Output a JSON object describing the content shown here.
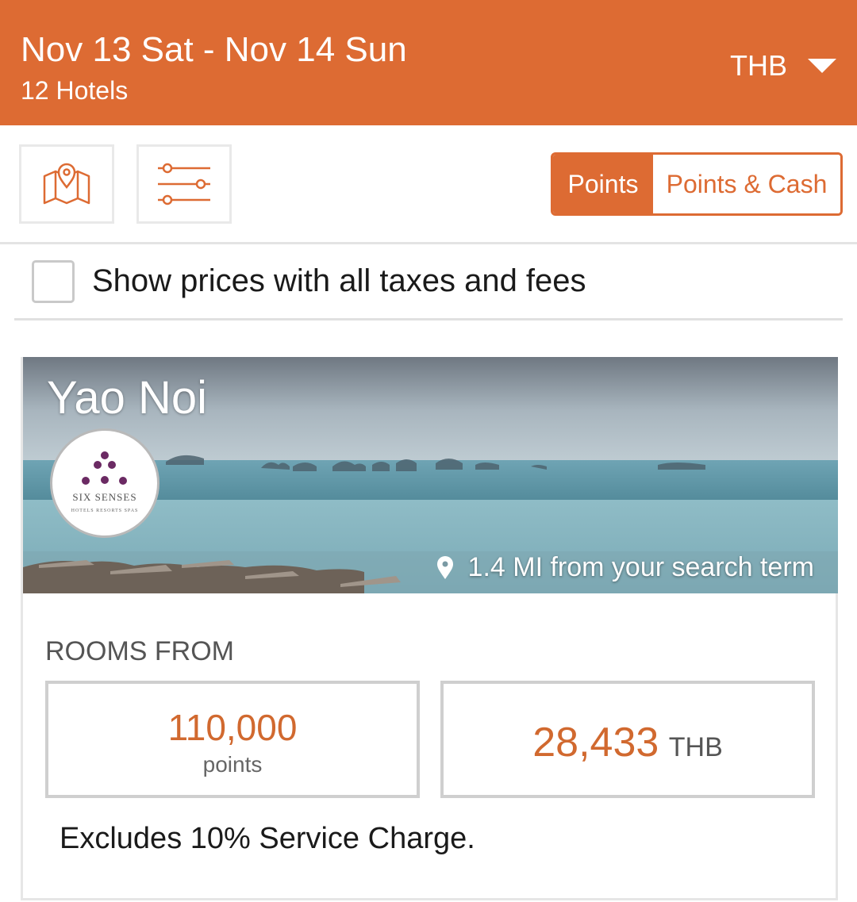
{
  "header": {
    "dates": "Nov 13 Sat - Nov 14 Sun",
    "hotel_count": "12 Hotels",
    "currency": "THB"
  },
  "toolbar": {
    "map_icon": "map-pin-icon",
    "filter_icon": "sliders-icon",
    "toggle": {
      "points_label": "Points",
      "points_cash_label": "Points & Cash",
      "selected": "Points"
    }
  },
  "tax_option": {
    "label": "Show prices with all taxes and fees",
    "checked": false
  },
  "hotel": {
    "name": "Yao Noi",
    "brand": "SIX SENSES",
    "brand_tagline": "HOTELS  RESORTS  SPAS",
    "distance": "1.4 MI from your search term",
    "rooms_from_label": "ROOMS FROM",
    "points_price": "110,000",
    "points_unit": "points",
    "cash_price": "28,433",
    "cash_currency": "THB",
    "note": "Excludes 10% Service Charge."
  },
  "colors": {
    "brand_orange": "#dd6b33",
    "price_orange": "#d1692f",
    "logo_purple": "#6b2a63"
  }
}
